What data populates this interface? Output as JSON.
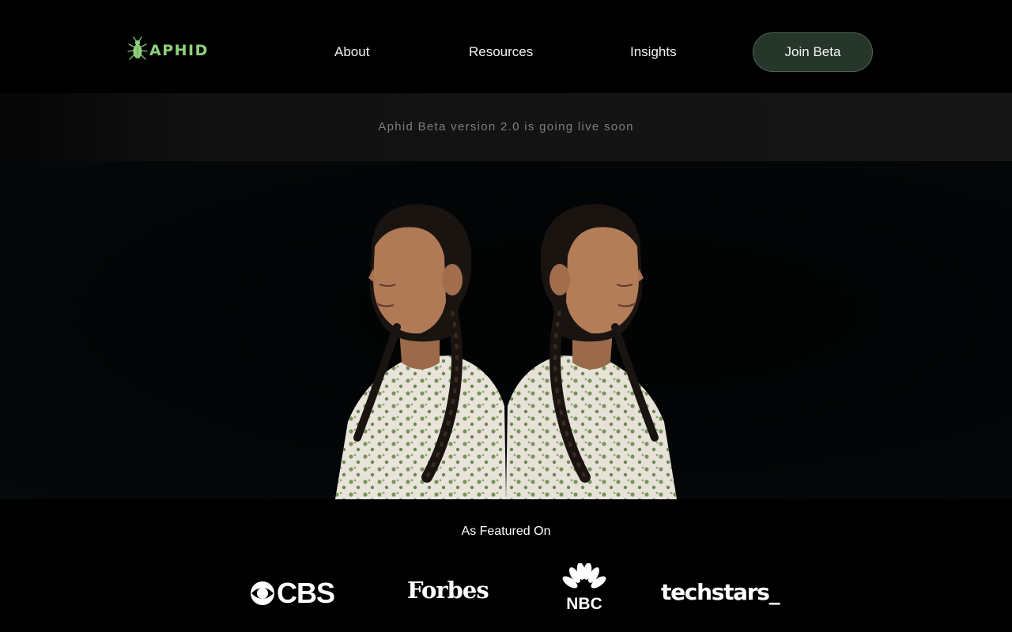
{
  "brand": {
    "name": "APHID",
    "accent_color": "#8fd07e",
    "icon": "aphid-bug-icon"
  },
  "nav": {
    "items": [
      {
        "label": "About"
      },
      {
        "label": "Resources"
      },
      {
        "label": "Insights"
      }
    ],
    "cta_label": "Join Beta",
    "cta_color": "#27362a"
  },
  "announcement": {
    "text": "Aphid Beta version 2.0 is going live soon"
  },
  "hero": {
    "image": "mirrored-portrait-of-two-young-women-with-braids"
  },
  "featured": {
    "title": "As Featured On",
    "logos": [
      {
        "name": "CBS",
        "text": "CBS",
        "icon": "cbs-eye-icon"
      },
      {
        "name": "Forbes",
        "text": "Forbes"
      },
      {
        "name": "NBC",
        "text": "NBC",
        "icon": "nbc-peacock-icon"
      },
      {
        "name": "Techstars",
        "text": "techstars_"
      }
    ]
  }
}
